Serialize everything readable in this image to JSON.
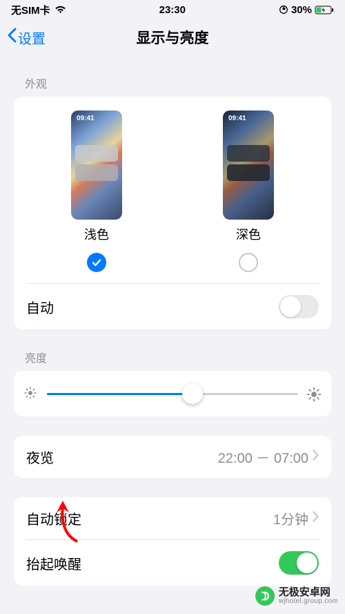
{
  "status": {
    "carrier": "无SIM卡",
    "time": "23:30",
    "battery_pct": "30%"
  },
  "nav": {
    "back_label": "设置",
    "title": "显示与亮度"
  },
  "appearance": {
    "header": "外观",
    "preview_time": "09:41",
    "light_label": "浅色",
    "dark_label": "深色",
    "selected": "light",
    "auto_label": "自动",
    "auto_on": false
  },
  "brightness": {
    "header": "亮度",
    "value_pct": 58
  },
  "night_shift": {
    "label": "夜览",
    "value": "22:00 － 07:00"
  },
  "auto_lock": {
    "label": "自动锁定",
    "value": "1分钟"
  },
  "raise_to_wake": {
    "label": "抬起唤醒",
    "on": true
  },
  "watermark": {
    "line1": "无极安卓网",
    "line2": "wjhotel.group.com"
  }
}
